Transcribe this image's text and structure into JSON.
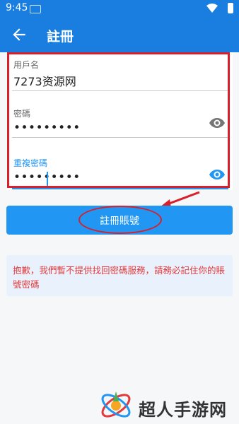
{
  "status_bar": {
    "time": "9:45"
  },
  "app_bar": {
    "title": "註冊"
  },
  "form": {
    "username": {
      "label": "用戶名",
      "value": "7273资源网"
    },
    "password": {
      "label": "密碼",
      "value": "•••••••••"
    },
    "confirm_password": {
      "label": "重複密碼",
      "value": "•••••••••"
    }
  },
  "register_button": {
    "label": "註冊賬號"
  },
  "notice": {
    "text": "抱歉，我們暫不提供找回密碼服務，請務必記住你的賬號密碼"
  },
  "watermark": {
    "text": "超人手游网"
  },
  "colors": {
    "primary": "#2196f3",
    "app_bar": "#1a7ee0",
    "notice_text": "#e4393c",
    "annotation": "#d81f2a"
  }
}
